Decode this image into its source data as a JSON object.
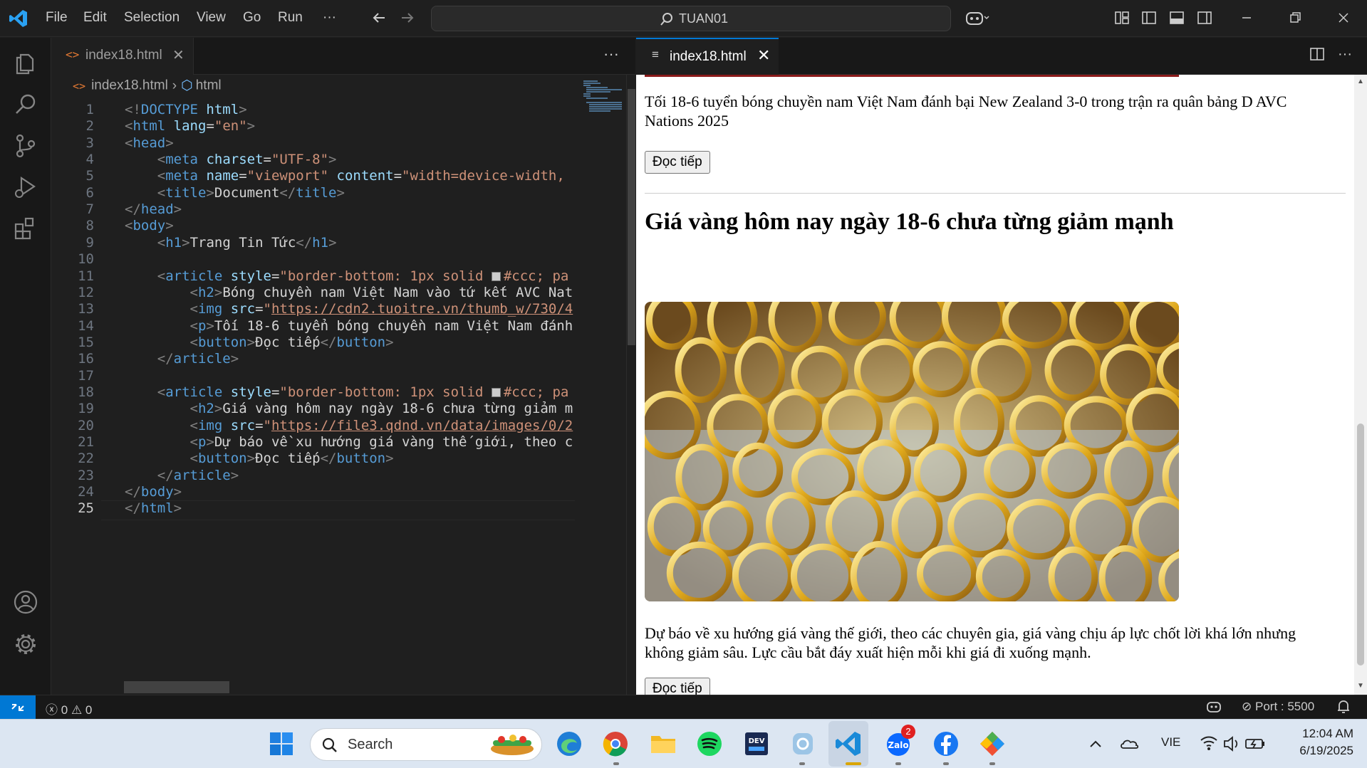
{
  "titlebar": {
    "menu": [
      "File",
      "Edit",
      "Selection",
      "View",
      "Go",
      "Run",
      "···"
    ],
    "command_center": "TUAN01"
  },
  "editor": {
    "tab_label": "index18.html",
    "more": "···",
    "breadcrumb": {
      "file": "index18.html",
      "symbol": "html"
    },
    "current_line": 25
  },
  "code_lines": [
    [
      [
        "br",
        "<!"
      ],
      [
        "tag",
        "DOCTYPE"
      ],
      [
        "tx",
        " "
      ],
      [
        "at",
        "html"
      ],
      [
        "br",
        ">"
      ]
    ],
    [
      [
        "br",
        "<"
      ],
      [
        "tag",
        "html"
      ],
      [
        "tx",
        " "
      ],
      [
        "at",
        "lang"
      ],
      [
        "tx",
        "="
      ],
      [
        "str",
        "\"en\""
      ],
      [
        "br",
        ">"
      ]
    ],
    [
      [
        "br",
        "<"
      ],
      [
        "tag",
        "head"
      ],
      [
        "br",
        ">"
      ]
    ],
    [
      [
        "tx",
        "    "
      ],
      [
        "br",
        "<"
      ],
      [
        "tag",
        "meta"
      ],
      [
        "tx",
        " "
      ],
      [
        "at",
        "charset"
      ],
      [
        "tx",
        "="
      ],
      [
        "str",
        "\"UTF-8\""
      ],
      [
        "br",
        ">"
      ]
    ],
    [
      [
        "tx",
        "    "
      ],
      [
        "br",
        "<"
      ],
      [
        "tag",
        "meta"
      ],
      [
        "tx",
        " "
      ],
      [
        "at",
        "name"
      ],
      [
        "tx",
        "="
      ],
      [
        "str",
        "\"viewport\""
      ],
      [
        "tx",
        " "
      ],
      [
        "at",
        "content"
      ],
      [
        "tx",
        "="
      ],
      [
        "str",
        "\"width=device-width,"
      ]
    ],
    [
      [
        "tx",
        "    "
      ],
      [
        "br",
        "<"
      ],
      [
        "tag",
        "title"
      ],
      [
        "br",
        ">"
      ],
      [
        "tx",
        "Document"
      ],
      [
        "br",
        "</"
      ],
      [
        "tag",
        "title"
      ],
      [
        "br",
        ">"
      ]
    ],
    [
      [
        "br",
        "</"
      ],
      [
        "tag",
        "head"
      ],
      [
        "br",
        ">"
      ]
    ],
    [
      [
        "br",
        "<"
      ],
      [
        "tag",
        "body"
      ],
      [
        "br",
        ">"
      ]
    ],
    [
      [
        "tx",
        "    "
      ],
      [
        "br",
        "<"
      ],
      [
        "tag",
        "h1"
      ],
      [
        "br",
        ">"
      ],
      [
        "tx",
        "Trang Tin Tức"
      ],
      [
        "br",
        "</"
      ],
      [
        "tag",
        "h1"
      ],
      [
        "br",
        ">"
      ]
    ],
    [],
    [
      [
        "tx",
        "    "
      ],
      [
        "br",
        "<"
      ],
      [
        "tag",
        "article"
      ],
      [
        "tx",
        " "
      ],
      [
        "at",
        "style"
      ],
      [
        "tx",
        "="
      ],
      [
        "str",
        "\"border-bottom: 1px solid "
      ],
      [
        "sw",
        ""
      ],
      [
        "str",
        "#ccc; pa"
      ]
    ],
    [
      [
        "tx",
        "        "
      ],
      [
        "br",
        "<"
      ],
      [
        "tag",
        "h2"
      ],
      [
        "br",
        ">"
      ],
      [
        "tx",
        "Bóng chuyền nam Việt Nam vào tứ kết AVC Nat"
      ]
    ],
    [
      [
        "tx",
        "        "
      ],
      [
        "br",
        "<"
      ],
      [
        "tag",
        "img"
      ],
      [
        "tx",
        " "
      ],
      [
        "at",
        "src"
      ],
      [
        "tx",
        "="
      ],
      [
        "str",
        "\""
      ],
      [
        "url",
        "https://cdn2.tuoitre.vn/thumb_w/730/4"
      ]
    ],
    [
      [
        "tx",
        "        "
      ],
      [
        "br",
        "<"
      ],
      [
        "tag",
        "p"
      ],
      [
        "br",
        ">"
      ],
      [
        "tx",
        "Tối 18-6 tuyển bóng chuyền nam Việt Nam đánh"
      ]
    ],
    [
      [
        "tx",
        "        "
      ],
      [
        "br",
        "<"
      ],
      [
        "tag",
        "button"
      ],
      [
        "br",
        ">"
      ],
      [
        "tx",
        "Đọc tiếp"
      ],
      [
        "br",
        "</"
      ],
      [
        "tag",
        "button"
      ],
      [
        "br",
        ">"
      ]
    ],
    [
      [
        "tx",
        "    "
      ],
      [
        "br",
        "</"
      ],
      [
        "tag",
        "article"
      ],
      [
        "br",
        ">"
      ]
    ],
    [],
    [
      [
        "tx",
        "    "
      ],
      [
        "br",
        "<"
      ],
      [
        "tag",
        "article"
      ],
      [
        "tx",
        " "
      ],
      [
        "at",
        "style"
      ],
      [
        "tx",
        "="
      ],
      [
        "str",
        "\"border-bottom: 1px solid "
      ],
      [
        "sw",
        ""
      ],
      [
        "str",
        "#ccc; pa"
      ]
    ],
    [
      [
        "tx",
        "        "
      ],
      [
        "br",
        "<"
      ],
      [
        "tag",
        "h2"
      ],
      [
        "br",
        ">"
      ],
      [
        "tx",
        "Giá vàng hôm nay ngày 18-6 chưa từng giảm m"
      ]
    ],
    [
      [
        "tx",
        "        "
      ],
      [
        "br",
        "<"
      ],
      [
        "tag",
        "img"
      ],
      [
        "tx",
        " "
      ],
      [
        "at",
        "src"
      ],
      [
        "tx",
        "="
      ],
      [
        "str",
        "\""
      ],
      [
        "url",
        "https://file3.qdnd.vn/data/images/0/2"
      ]
    ],
    [
      [
        "tx",
        "        "
      ],
      [
        "br",
        "<"
      ],
      [
        "tag",
        "p"
      ],
      [
        "br",
        ">"
      ],
      [
        "tx",
        "Dự báo về xu hướng giá vàng thế giới, theo c"
      ]
    ],
    [
      [
        "tx",
        "        "
      ],
      [
        "br",
        "<"
      ],
      [
        "tag",
        "button"
      ],
      [
        "br",
        ">"
      ],
      [
        "tx",
        "Đọc tiếp"
      ],
      [
        "br",
        "</"
      ],
      [
        "tag",
        "button"
      ],
      [
        "br",
        ">"
      ]
    ],
    [
      [
        "tx",
        "    "
      ],
      [
        "br",
        "</"
      ],
      [
        "tag",
        "article"
      ],
      [
        "br",
        ">"
      ]
    ],
    [
      [
        "br",
        "</"
      ],
      [
        "tag",
        "body"
      ],
      [
        "br",
        ">"
      ]
    ],
    [
      [
        "br",
        "</"
      ],
      [
        "tag",
        "html"
      ],
      [
        "br",
        ">"
      ]
    ]
  ],
  "preview": {
    "tab_label": "index18.html",
    "article1_text": "Tối 18-6 tuyển bóng chuyền nam Việt Nam đánh bại New Zealand 3-0 trong trận ra quân bảng D AVC Nations 2025",
    "button_label": "Đọc tiếp",
    "article2_title": "Giá vàng hôm nay ngày 18-6 chưa từng giảm mạnh",
    "article2_text": "Dự báo về xu hướng giá vàng thế giới, theo các chuyên gia, giá vàng chịu áp lực chốt lời khá lớn nhưng không giảm sâu. Lực cầu bắt đáy xuất hiện mỗi khi giá đi xuống mạnh."
  },
  "statusbar": {
    "errors": "0",
    "warnings": "0",
    "port": "Port : 5500"
  },
  "taskbar": {
    "search_label": "Search",
    "language": "VIE",
    "time": "12:04 AM",
    "date": "6/19/2025",
    "zalo_badge": "2"
  },
  "colors": {
    "accent": "#0078d4",
    "editor_bg": "#1f1f1f",
    "taskbar_bg": "#dce6f2"
  }
}
